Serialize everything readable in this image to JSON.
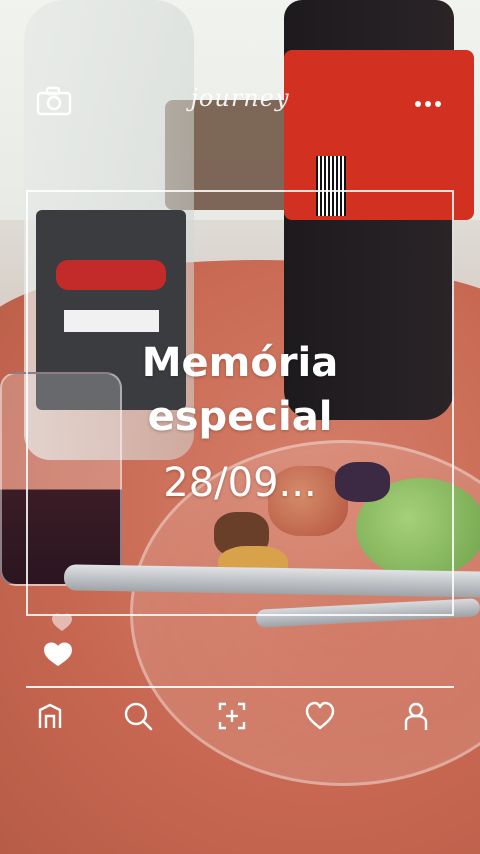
{
  "app": {
    "brand_text": "journey"
  },
  "card": {
    "title_line1": "Memória",
    "title_line2": "especial",
    "date": "28/09..."
  },
  "icons": {
    "top_left": "camera-icon",
    "top_right": "more-dots-icon",
    "hearts": "hearts-icon"
  },
  "bottom_nav": [
    {
      "name": "home",
      "icon": "home-icon"
    },
    {
      "name": "search",
      "icon": "search-icon"
    },
    {
      "name": "add",
      "icon": "add-post-icon"
    },
    {
      "name": "likes",
      "icon": "heart-icon"
    },
    {
      "name": "profile",
      "icon": "profile-icon"
    }
  ],
  "colors": {
    "ui_foreground": "#ffffff"
  }
}
